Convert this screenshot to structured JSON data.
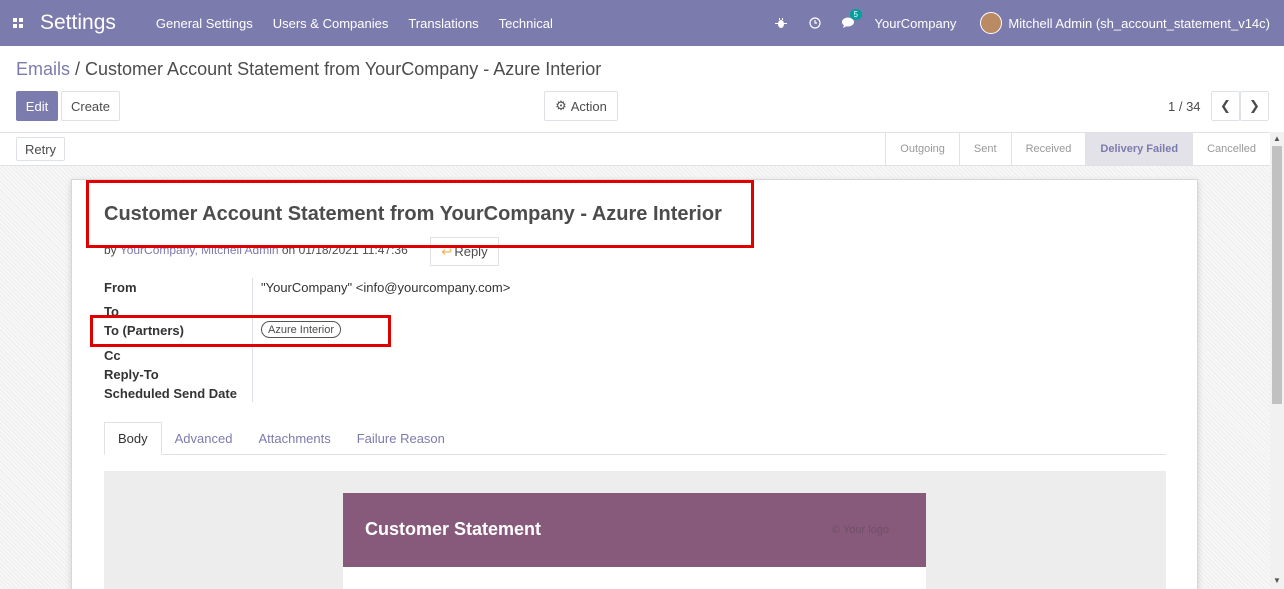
{
  "navbar": {
    "brand": "Settings",
    "menu": [
      "General Settings",
      "Users & Companies",
      "Translations",
      "Technical"
    ],
    "chat_count": "5",
    "company": "YourCompany",
    "user": "Mitchell Admin (sh_account_statement_v14c)"
  },
  "breadcrumb": {
    "parent": "Emails",
    "separator": " / ",
    "current": "Customer Account Statement from YourCompany - Azure Interior"
  },
  "controls": {
    "edit": "Edit",
    "create": "Create",
    "action": "Action",
    "pager": "1 / 34"
  },
  "statusbar": {
    "retry": "Retry",
    "stages": [
      "Outgoing",
      "Sent",
      "Received",
      "Delivery Failed",
      "Cancelled"
    ],
    "active_stage": "Delivery Failed"
  },
  "message": {
    "title": "Customer Account Statement from YourCompany - Azure Interior",
    "by_prefix": "by ",
    "author": "YourCompany, Mitchell Admin",
    "date": " on 01/18/2021 11:47:36",
    "reply": "Reply"
  },
  "fields": {
    "from_label": "From",
    "from_value": "\"YourCompany\" <info@yourcompany.com>",
    "to_label": "To",
    "partners_label": "To (Partners)",
    "partner_tag": "Azure Interior",
    "cc_label": "Cc",
    "reply_to_label": "Reply-To",
    "scheduled_label": "Scheduled Send Date"
  },
  "tabs": [
    "Body",
    "Advanced",
    "Attachments",
    "Failure Reason"
  ],
  "preview": {
    "heading": "Customer Statement",
    "corner_text": "© Your logo"
  },
  "colors": {
    "navbar": "#7c7bad",
    "email_header": "#875a7b",
    "highlight": "#e00000"
  }
}
